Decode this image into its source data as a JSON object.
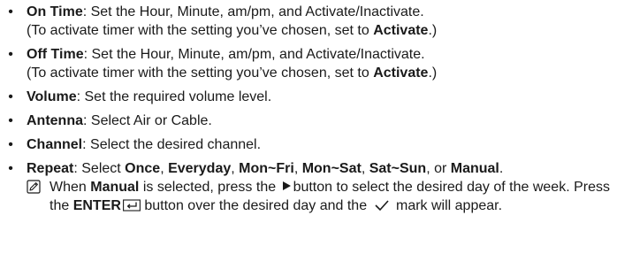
{
  "items": [
    {
      "term": "On Time",
      "text": ": Set the Hour, Minute, am/pm, and Activate/Inactivate.",
      "line2_pre": "(To activate timer with the setting you’ve chosen, set to ",
      "line2_bold": "Activate",
      "line2_post": ".)"
    },
    {
      "term": "Off Time",
      "text": ": Set the Hour, Minute, am/pm, and Activate/Inactivate.",
      "line2_pre": "(To activate timer with the setting you’ve chosen, set to ",
      "line2_bold": "Activate",
      "line2_post": ".)"
    },
    {
      "term": "Volume",
      "text": ": Set the required volume level."
    },
    {
      "term": "Antenna",
      "text": ": Select Air or Cable."
    },
    {
      "term": "Channel",
      "text": ": Select the desired channel."
    },
    {
      "term": "Repeat",
      "text": ": Select ",
      "options": [
        "Once",
        "Everyday",
        "Mon~Fri",
        "Mon~Sat",
        "Sat~Sun",
        "Manual"
      ],
      "sep": ", ",
      "or": ", or ",
      "end": ".",
      "note": {
        "part1": "When ",
        "manual": "Manual",
        "part2": " is selected, press the ",
        "part3": "button to select the desired day of the week. Press the ",
        "enter": "ENTER",
        "part4": " button over the desired day and the ",
        "part5": " mark will appear."
      }
    }
  ],
  "bullet_char": "•",
  "icons": {
    "note": "note-pencil-icon",
    "play": "right-arrow-icon",
    "enter": "enter-key-icon",
    "check": "checkmark-icon"
  }
}
